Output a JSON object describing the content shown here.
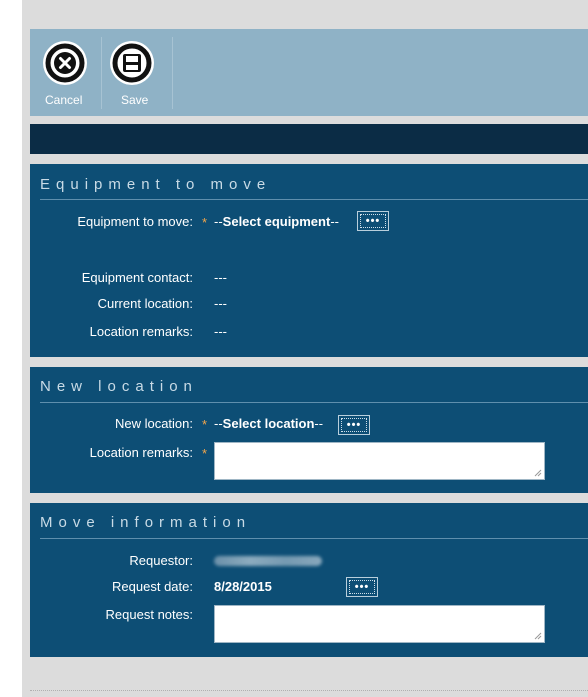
{
  "toolbar": {
    "cancel_label": "Cancel",
    "save_label": "Save"
  },
  "equipment_section": {
    "title": "Equipment to move",
    "equipment_label": "Equipment to move:",
    "equipment_prefix": "--",
    "equipment_value": "Select equipment",
    "equipment_suffix": "--",
    "contact_label": "Equipment contact:",
    "contact_value": "---",
    "current_location_label": "Current location:",
    "current_location_value": "---",
    "location_remarks_label": "Location remarks:",
    "location_remarks_value": "---"
  },
  "new_location_section": {
    "title": "New location",
    "new_location_label": "New location:",
    "new_location_prefix": "--",
    "new_location_value": "Select location",
    "new_location_suffix": "--",
    "location_remarks_label": "Location remarks:",
    "location_remarks_value": ""
  },
  "move_info_section": {
    "title": "Move information",
    "requestor_label": "Requestor:",
    "request_date_label": "Request date:",
    "request_date_value": "8/28/2015",
    "request_notes_label": "Request notes:",
    "request_notes_value": ""
  },
  "picker_button_label": "•••",
  "required_marker": "*",
  "colors": {
    "toolbar": "#8fb2c6",
    "section_bg": "#0d4e75",
    "dark_bar": "#0b2c45",
    "required": "#f4a64a"
  },
  "icons": {
    "cancel": "close-circle-icon",
    "save": "floppy-disk-icon"
  }
}
